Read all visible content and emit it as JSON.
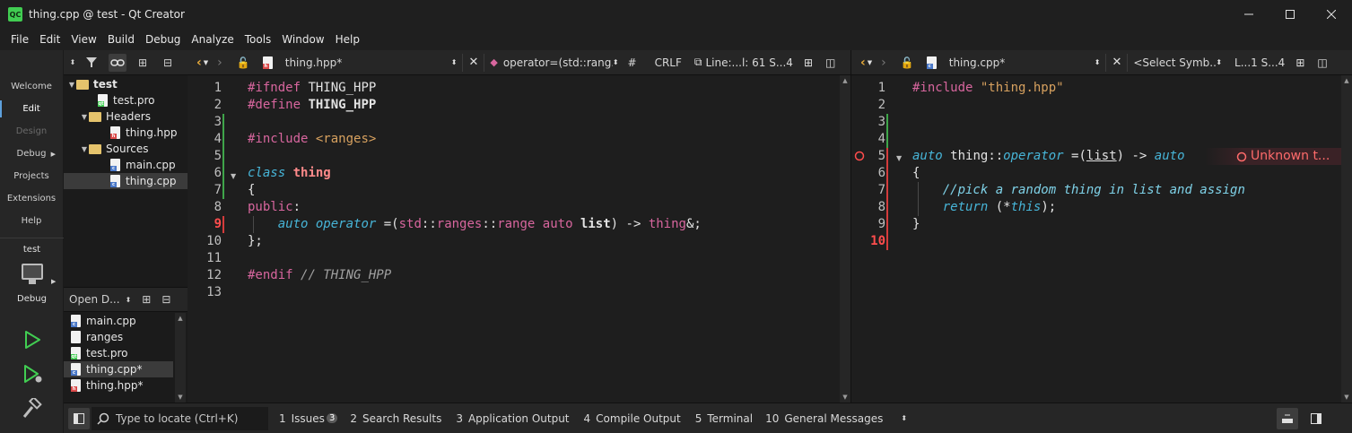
{
  "window": {
    "title": "thing.cpp @ test - Qt Creator",
    "logo": "QC"
  },
  "menu": [
    "File",
    "Edit",
    "View",
    "Build",
    "Debug",
    "Analyze",
    "Tools",
    "Window",
    "Help"
  ],
  "modes": [
    {
      "label": "Welcome"
    },
    {
      "label": "Edit"
    },
    {
      "label": "Design"
    },
    {
      "label": "Debug"
    },
    {
      "label": "Projects"
    },
    {
      "label": "Extensions"
    },
    {
      "label": "Help"
    }
  ],
  "kit": {
    "project": "test",
    "mode": "Debug"
  },
  "project_tree": [
    {
      "label": "test"
    },
    {
      "label": "test.pro"
    },
    {
      "label": "Headers"
    },
    {
      "label": "thing.hpp"
    },
    {
      "label": "Sources"
    },
    {
      "label": "main.cpp"
    },
    {
      "label": "thing.cpp"
    }
  ],
  "open_documents": {
    "title": "Open D...",
    "items": [
      "main.cpp",
      "ranges",
      "test.pro",
      "thing.cpp*",
      "thing.hpp*"
    ]
  },
  "left_editor": {
    "file": "thing.hpp*",
    "symbol": "operator=(std::rang...",
    "hash": "#",
    "eol": "CRLF",
    "position": "Line:...l: 61 S...4",
    "line_numbers": [
      "1",
      "2",
      "3",
      "4",
      "5",
      "6",
      "7",
      "8",
      "9",
      "10",
      "11",
      "12",
      "13"
    ]
  },
  "right_editor": {
    "file": "thing.cpp*",
    "symbol": "<Select Symb...",
    "position": "L...1 S...4",
    "line_numbers": [
      "1",
      "2",
      "3",
      "4",
      "5",
      "6",
      "7",
      "8",
      "9",
      "10"
    ],
    "diagnostic": "Unknown t..."
  },
  "code_tokens": {
    "ifndef": "#ifndef",
    "thing_hpp": "THING_HPP",
    "define": "#define",
    "include": "#include",
    "ranges_hdr": "<ranges>",
    "class": "class",
    "thing": "thing",
    "brace_open": "{",
    "public": "public",
    "colon": ":",
    "auto": "auto",
    "operator": "operator",
    "assign_paren": " =(",
    "std": "std",
    "dcolon": "::",
    "ranges": "ranges",
    "range": "range",
    "list": "list",
    "arrow": ") -> ",
    "amp_semi": "&;",
    "brace_close_semi": "};",
    "endif": "#endif",
    "endif_comment": "// THING_HPP",
    "thing_hpp_str": "\"thing.hpp\"",
    "thing_dcolon": "thing",
    "list_paren": "(list)",
    "arrow2": " -> ",
    "comment": "//pick a random thing in list and assign",
    "return": "return",
    "star_this_open": " (",
    "star": "*",
    "this": "this",
    "close_semi": ");",
    "brace_close": "}"
  },
  "status": {
    "locator_placeholder": "Type to locate (Ctrl+K)",
    "outputs": [
      {
        "n": "1",
        "label": "Issues",
        "badge": "3"
      },
      {
        "n": "2",
        "label": "Search Results"
      },
      {
        "n": "3",
        "label": "Application Output"
      },
      {
        "n": "4",
        "label": "Compile Output"
      },
      {
        "n": "5",
        "label": "Terminal"
      },
      {
        "n": "10",
        "label": "General Messages"
      }
    ]
  },
  "colors": {
    "accent": "#5ea0dc",
    "run_green": "#41cd52",
    "error_red": "#ff4d4d"
  }
}
